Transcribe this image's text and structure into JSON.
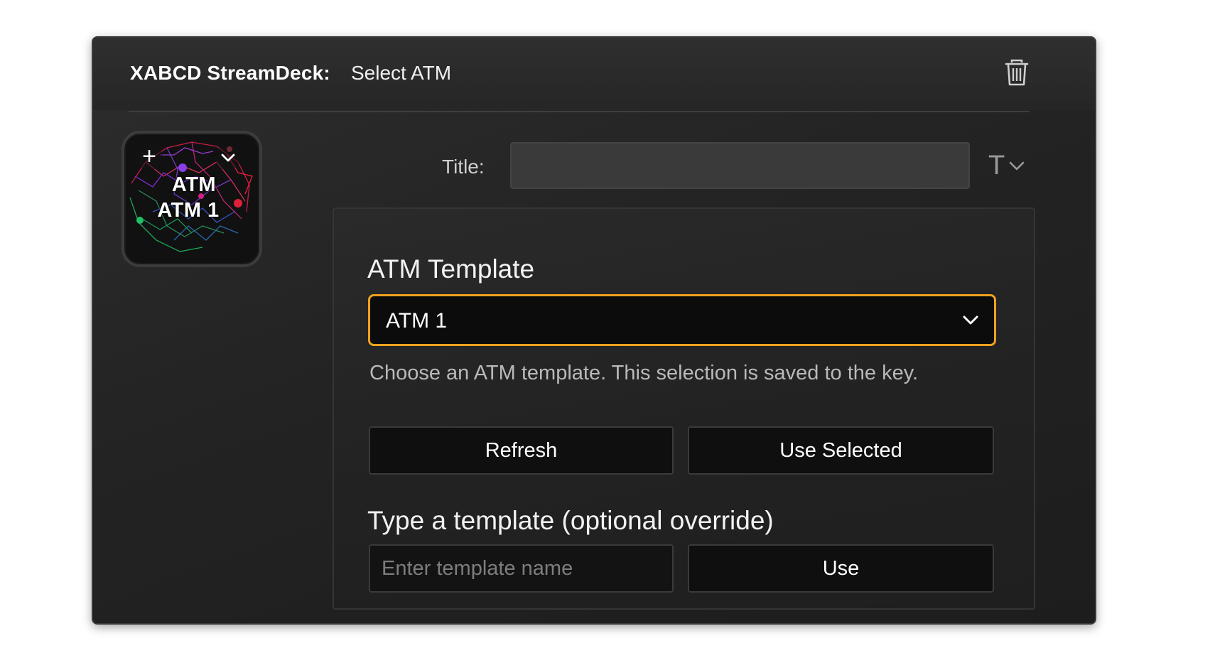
{
  "header": {
    "app_name": "XABCD StreamDeck:",
    "action_name": "Select ATM",
    "delete_icon": "trash-icon"
  },
  "key_preview": {
    "line1": "ATM",
    "line2": "ATM 1",
    "add_icon": "plus-icon",
    "menu_icon": "chevron-down-icon"
  },
  "title_field": {
    "label": "Title:",
    "value": "",
    "format_label": "T",
    "format_icon": "chevron-down-icon"
  },
  "atm_template": {
    "heading": "ATM Template",
    "selected": "ATM 1",
    "help": "Choose an ATM template. This selection is saved to the key.",
    "refresh_label": "Refresh",
    "use_selected_label": "Use Selected"
  },
  "override": {
    "heading": "Type a template (optional override)",
    "placeholder": "Enter template name",
    "use_label": "Use"
  },
  "colors": {
    "accent": "#f0a11e",
    "background": "#262626",
    "button": "#0f0f0f"
  }
}
